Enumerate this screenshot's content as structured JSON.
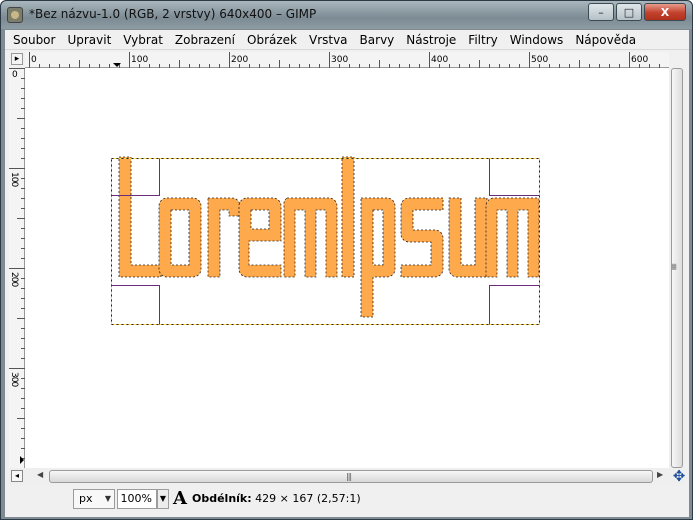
{
  "window": {
    "title": "*Bez názvu-1.0 (RGB, 2 vrstvy) 640x400 – GIMP",
    "buttons": {
      "minimize": "–",
      "maximize": "□",
      "close": "X"
    }
  },
  "menubar": {
    "items": [
      {
        "label": "Soubor"
      },
      {
        "label": "Upravit"
      },
      {
        "label": "Vybrat"
      },
      {
        "label": "Zobrazení"
      },
      {
        "label": "Obrázek"
      },
      {
        "label": "Vrstva"
      },
      {
        "label": "Barvy"
      },
      {
        "label": "Nástroje"
      },
      {
        "label": "Filtry"
      },
      {
        "label": "Windows"
      },
      {
        "label": "Nápověda"
      }
    ]
  },
  "rulers": {
    "horizontal_labels": [
      "0",
      "100",
      "200",
      "300",
      "400",
      "500",
      "600"
    ],
    "vertical_labels": [
      "0",
      "100",
      "200",
      "300"
    ]
  },
  "canvas": {
    "text_layer": "LoremIpsum",
    "text_color": "#ffa94d",
    "background": "#ffffff"
  },
  "statusbar": {
    "unit": "px",
    "zoom": "100%",
    "tool_glyph": "A",
    "tool_label": "Obdélník:",
    "tool_info": "429 × 167  (2,57:1)"
  },
  "colors": {
    "accent_close": "#c2412c",
    "selection_dash": "#d4a000",
    "guide": "#6a2d7a"
  }
}
